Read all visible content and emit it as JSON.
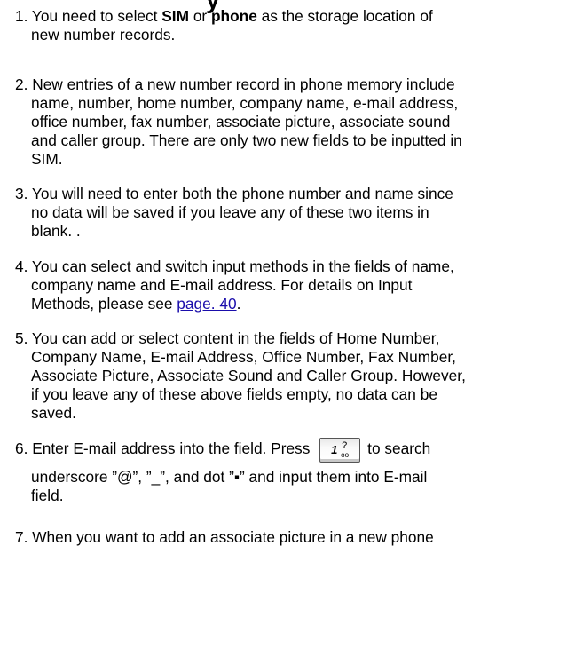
{
  "heading_fragment": "y",
  "items": [
    {
      "lines": [
        {
          "segments": [
            {
              "text": "1. You need to select "
            },
            {
              "text": "SIM",
              "bold": true
            },
            {
              "text": " or "
            },
            {
              "text": "phone",
              "bold": true
            },
            {
              "text": " as the storage location of"
            }
          ]
        },
        {
          "segments": [
            {
              "text": "new number records."
            }
          ]
        }
      ]
    },
    {
      "lines": [
        {
          "segments": [
            {
              "text": "2. New entries of a new number record in phone memory include"
            }
          ]
        },
        {
          "segments": [
            {
              "text": "name, number, home number, company name, e-mail address,"
            }
          ]
        },
        {
          "segments": [
            {
              "text": "office number, fax number, associate picture, associate sound"
            }
          ]
        },
        {
          "segments": [
            {
              "text": "and caller group. There are only two new fields to be inputted in"
            }
          ]
        },
        {
          "segments": [
            {
              "text": "SIM."
            }
          ]
        }
      ]
    },
    {
      "lines": [
        {
          "segments": [
            {
              "text": "3. You will need to enter both the phone number and name since"
            }
          ]
        },
        {
          "segments": [
            {
              "text": "no data will be saved if you leave any of these two items in"
            }
          ]
        },
        {
          "segments": [
            {
              "text": "blank. ."
            }
          ]
        }
      ]
    },
    {
      "lines": [
        {
          "segments": [
            {
              "text": "4. You can select and switch input methods in the fields of name,"
            }
          ]
        },
        {
          "segments": [
            {
              "text": "company name and E-mail address. For details on Input"
            }
          ]
        },
        {
          "segments": [
            {
              "text": "Methods, please see "
            },
            {
              "text": "page. 40",
              "link": true
            },
            {
              "text": "."
            }
          ]
        }
      ]
    },
    {
      "lines": [
        {
          "segments": [
            {
              "text": "5. You can add or select content in the fields of Home Number,"
            }
          ]
        },
        {
          "segments": [
            {
              "text": "Company Name, E-mail Address, Office Number, Fax Number,"
            }
          ]
        },
        {
          "segments": [
            {
              "text": "Associate Picture, Associate Sound and Caller Group. However,"
            }
          ]
        },
        {
          "segments": [
            {
              "text": "if you leave any of these above fields empty, no data can be"
            }
          ]
        },
        {
          "segments": [
            {
              "text": "saved."
            }
          ]
        }
      ]
    },
    {
      "lines": [
        {
          "segments": [
            {
              "text": "6. Enter E-mail address into the field. Press "
            },
            {
              "key_icon": "one-key-icon",
              "key_label": "1",
              "key_sub": "?",
              "key_voicemail": "oo"
            },
            {
              "text": "to search"
            }
          ]
        },
        {
          "segments": [
            {
              "text": "underscore ”@”, ”_”, and dot ”▪” and input them into E-mail"
            }
          ]
        },
        {
          "segments": [
            {
              "text": "field."
            }
          ]
        }
      ]
    },
    {
      "lines": [
        {
          "segments": [
            {
              "text": "7. When you want to add an associate picture in a new phone"
            }
          ]
        }
      ]
    }
  ]
}
